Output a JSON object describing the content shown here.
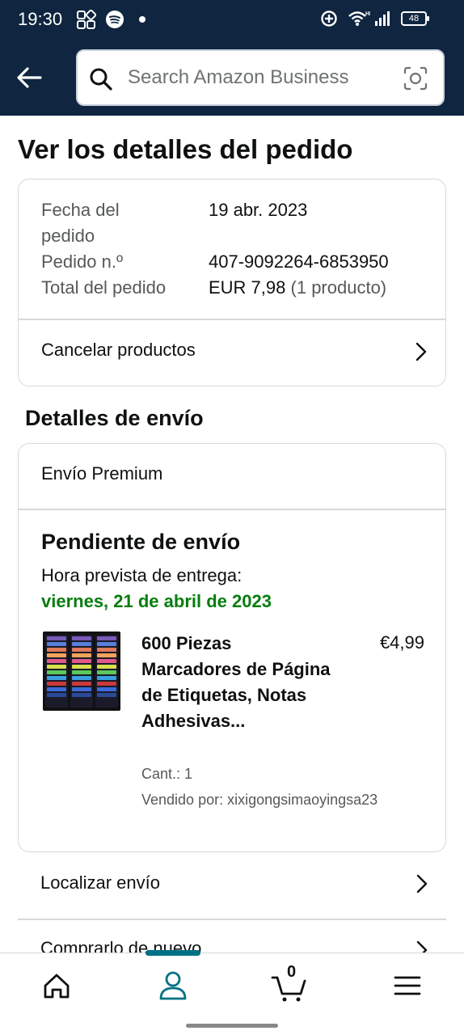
{
  "status_bar": {
    "time": "19:30",
    "battery": "48",
    "icons": [
      "grid-icon",
      "spotify-icon",
      "dot-icon",
      "vpn-icon",
      "wifi-icon",
      "signal-icon",
      "battery-icon"
    ]
  },
  "header": {
    "search_placeholder": "Search Amazon Business",
    "back_icon": "arrow-left-icon",
    "camera_icon": "camera-scan-icon"
  },
  "page": {
    "title": "Ver los detalles del pedido"
  },
  "order_summary": {
    "date_label_line1": "Fecha del",
    "date_label_line2": "pedido",
    "date_value": "19 abr. 2023",
    "number_label": "Pedido n.º",
    "number_value": "407-9092264-6853950",
    "total_label": "Total del pedido",
    "total_value": "EUR 7,98",
    "total_items": "(1 producto)",
    "cancel_label": "Cancelar productos"
  },
  "shipping": {
    "section_title": "Detalles de envío",
    "type": "Envío Premium",
    "status": "Pendiente de envío",
    "eta_label": "Hora prevista de entrega:",
    "eta_date": "viernes, 21 de abril de 2023",
    "product": {
      "title": "600 Piezas Marcadores de Página de Etiquetas, Notas Adhesivas...",
      "price": "€4,99",
      "qty": "Cant.: 1",
      "seller": "Vendido por: xixigongsimaoyingsa23"
    },
    "track_label": "Localizar envío",
    "buy_again_label": "Comprarlo de nuevo"
  },
  "bottom_nav": {
    "items": [
      "home-icon",
      "account-icon",
      "cart-icon",
      "menu-icon"
    ],
    "cart_count": "0",
    "active": "account-icon",
    "accent": "#007185"
  },
  "colors": {
    "header_bg": "#0f2540",
    "eta_green": "#067d0e",
    "border": "#d5d9d9"
  }
}
